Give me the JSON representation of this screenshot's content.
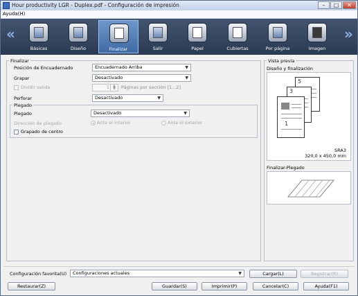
{
  "window": {
    "title": "Hour productivity LGR - Duplex.pdf - Configuración de impresión",
    "minimize": "–",
    "maximize": "□",
    "close": "✕"
  },
  "menu": {
    "help": "Ayuda(H)"
  },
  "ribbon": {
    "prev": "«",
    "next": "»",
    "tabs": [
      {
        "label": "Básicas"
      },
      {
        "label": "Diseño"
      },
      {
        "label": "Finalizar"
      },
      {
        "label": "Salir"
      },
      {
        "label": "Papel"
      },
      {
        "label": "Cubiertas"
      },
      {
        "label": "Por página"
      },
      {
        "label": "Imagen"
      }
    ]
  },
  "finalizar": {
    "title": "Finalizar",
    "binding_label": "Posición de Encuadernado",
    "binding_value": "Encuadernado Arriba",
    "staple_label": "Grapar",
    "staple_value": "Desactivado",
    "split_label": "Dividir salida",
    "pages_value": "1",
    "pages_label": "Páginas por sección [1...2]",
    "punch_label": "Perforar",
    "punch_value": "Desactivado"
  },
  "plegado": {
    "title": "Plegado",
    "fold_label": "Plegado",
    "fold_value": "Desactivado",
    "direction_label": "Dirección de plegado",
    "direction_inside": "Ante el interior",
    "direction_outside": "Ante el exterior",
    "center_staple": "Grapado de centro"
  },
  "preview": {
    "title": "Vista previa",
    "subtitle": "Diseño y finalización",
    "paper_name": "SRA3",
    "paper_size": "320,0 x 450,0 mm",
    "page_numbers": [
      "5",
      "3",
      "1"
    ],
    "fold_title": "Finalizar-Plegado"
  },
  "footer": {
    "favorite_label": "Configuración favorita(U)",
    "favorite_value": "Configuraciones actuales",
    "load": "Cargar(L)",
    "register": "Registrar(R)",
    "restore": "Restaurar(Z)",
    "save": "Guardar(S)",
    "print": "Imprimir(P)",
    "cancel": "Cancelar(C)",
    "help": "Ayuda(F1)"
  }
}
